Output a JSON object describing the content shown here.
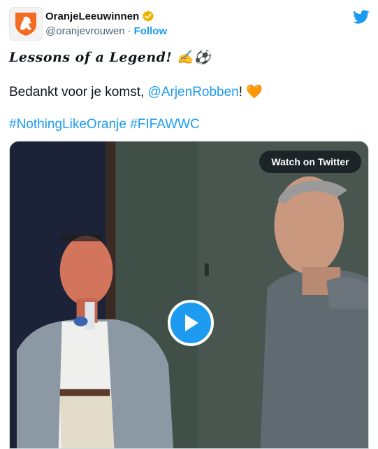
{
  "account": {
    "display_name": "OranjeLeeuwinnen",
    "handle": "@oranjevrouwen",
    "separator": "·",
    "follow_label": "Follow"
  },
  "tweet": {
    "title": "Lessons of a Legend",
    "title_suffix": "!",
    "title_emojis": "✍️⚽",
    "thanks_text": "Bedankt voor je komst, ",
    "mention": "@ArjenRobben",
    "thanks_suffix": "!",
    "heart_emoji": "🧡",
    "hashtags": [
      "#NothingLikeOranje",
      "#FIFAWWC"
    ]
  },
  "media": {
    "watch_label": "Watch on Twitter",
    "play_icon": "play-icon"
  },
  "colors": {
    "link": "#1d9bf0",
    "brand_orange": "#f36c21",
    "text": "#0f1419",
    "secondary": "#536471"
  }
}
